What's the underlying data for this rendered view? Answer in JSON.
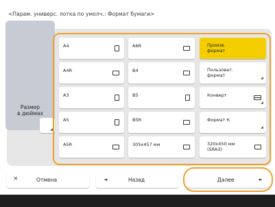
{
  "title": "<Парам. универс. лотка по умолч.: Формат бумаги>",
  "inch_button": {
    "label_line1": "Размер",
    "label_line2": "в дюймах"
  },
  "paper_sizes": {
    "c1": [
      {
        "label": "A4",
        "icon": "portrait-sheet-icon"
      },
      {
        "label": "A4R",
        "icon": "landscape-sheet-icon"
      },
      {
        "label": "A3",
        "icon": "portrait-sheet-icon"
      },
      {
        "label": "A5",
        "icon": "portrait-sheet-icon"
      },
      {
        "label": "A5R",
        "icon": "landscape-sheet-icon"
      }
    ],
    "c2": [
      {
        "label": "A6R",
        "icon": "landscape-sheet-icon"
      },
      {
        "label": "B4",
        "icon": "landscape-sheet-icon"
      },
      {
        "label": "B5",
        "icon": "portrait-sheet-icon"
      },
      {
        "label": "B5R",
        "icon": "landscape-sheet-icon"
      },
      {
        "label": "305x457 мм",
        "icon": "landscape-sheet-icon"
      }
    ],
    "c3": [
      {
        "line1": "Произв.",
        "line2": "формат",
        "selected": true
      },
      {
        "line1": "Пользоват.",
        "line2": "формат"
      },
      {
        "line1": "Конверт",
        "line2": ""
      },
      {
        "line1": "Формат К",
        "line2": ""
      },
      {
        "line1": "320x450 мм",
        "line2": "(SRA3)"
      }
    ]
  },
  "buttons": {
    "cancel": {
      "label": "Отмена",
      "icon": "×"
    },
    "back": {
      "label": "Назад",
      "icon": "◄"
    },
    "next": {
      "label": "Далее",
      "icon": "►"
    }
  },
  "colors": {
    "highlight": "#f0a02c",
    "selected": "#f4ce00",
    "bar": "#1e1e1e"
  }
}
